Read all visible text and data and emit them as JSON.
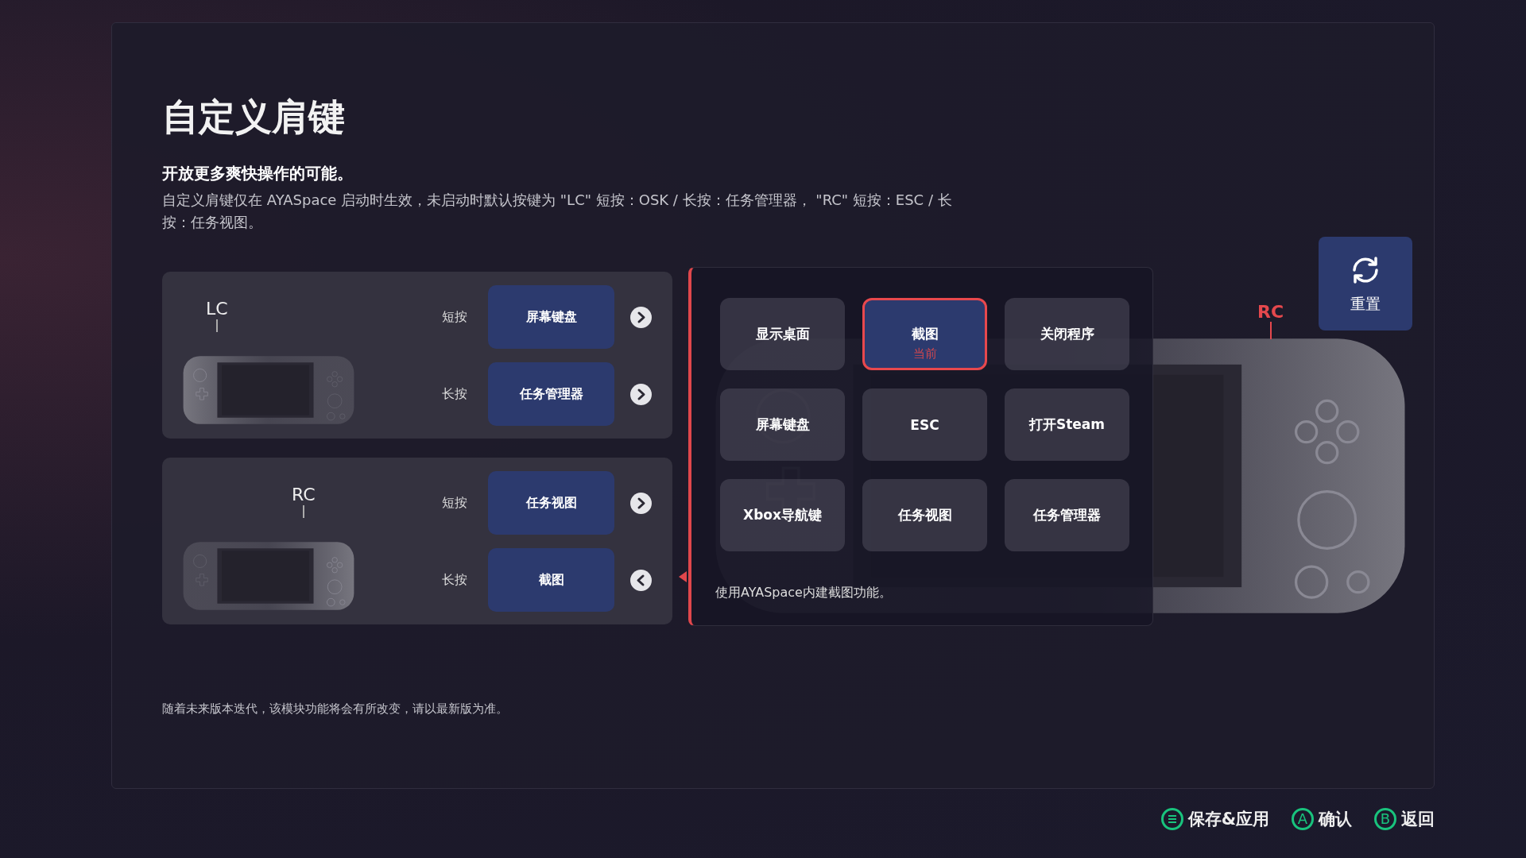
{
  "title": "自定义肩键",
  "subtitle": "开放更多爽快操作的可能。",
  "description": "自定义肩键仅在 AYASpace 启动时生效，未启动时默认按键为 \"LC\" 短按：OSK / 长按：任务管理器， \"RC\" 短按：ESC / 长按：任务视图。",
  "controllers": [
    {
      "label": "LC",
      "kind": "left",
      "actions": [
        {
          "press": "短按",
          "value": "屏幕键盘",
          "expanded": false
        },
        {
          "press": "长按",
          "value": "任务管理器",
          "expanded": false
        }
      ]
    },
    {
      "label": "RC",
      "kind": "right",
      "actions": [
        {
          "press": "短按",
          "value": "任务视图",
          "expanded": false
        },
        {
          "press": "长按",
          "value": "截图",
          "expanded": true
        }
      ]
    }
  ],
  "popup": {
    "options": [
      {
        "label": "显示桌面",
        "selected": false
      },
      {
        "label": "截图",
        "selected": true
      },
      {
        "label": "关闭程序",
        "selected": false
      },
      {
        "label": "屏幕键盘",
        "selected": false
      },
      {
        "label": "ESC",
        "selected": false
      },
      {
        "label": "打开Steam",
        "selected": false
      },
      {
        "label": "Xbox导航键",
        "selected": false
      },
      {
        "label": "任务视图",
        "selected": false
      },
      {
        "label": "任务管理器",
        "selected": false
      }
    ],
    "current_label": "当前",
    "hint": "使用AYASpace内建截图功能。"
  },
  "device_callout": "RC",
  "reset": {
    "label": "重置"
  },
  "footer_note": "随着未来版本迭代，该模块功能将会有所改变，请以最新版为准。",
  "hints": [
    {
      "kind": "menu",
      "label": "保存&应用"
    },
    {
      "kind": "letter",
      "glyph": "A",
      "label": "确认"
    },
    {
      "kind": "letter",
      "glyph": "B",
      "label": "返回"
    }
  ]
}
